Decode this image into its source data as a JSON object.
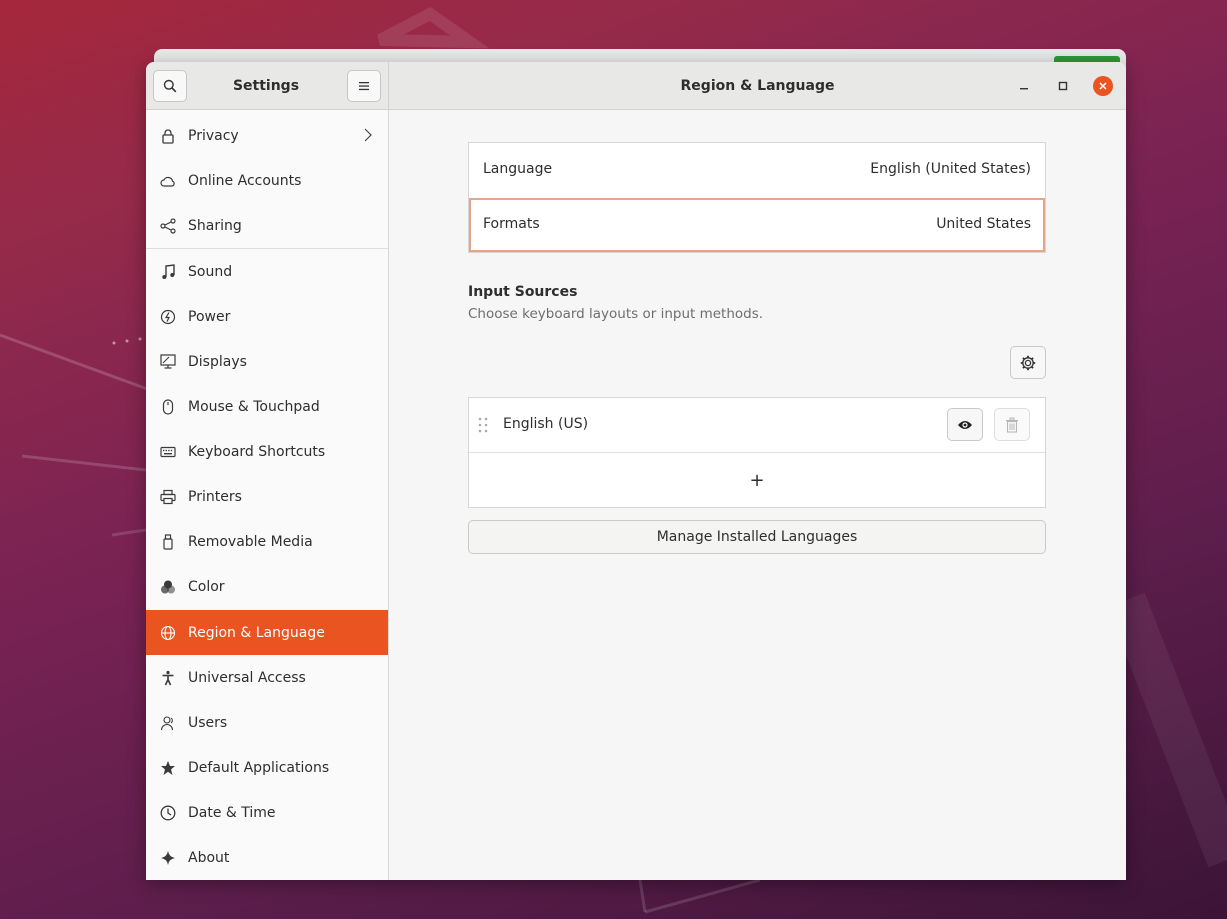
{
  "window": {
    "sidebar_title": "Settings",
    "main_title": "Region & Language"
  },
  "sidebar": {
    "items": [
      {
        "label": "Privacy",
        "icon": "lock-icon"
      },
      {
        "label": "Online Accounts",
        "icon": "cloud-icon"
      },
      {
        "label": "Sharing",
        "icon": "share-icon"
      },
      {
        "label": "Sound",
        "icon": "music-note-icon"
      },
      {
        "label": "Power",
        "icon": "power-icon"
      },
      {
        "label": "Displays",
        "icon": "display-icon"
      },
      {
        "label": "Mouse & Touchpad",
        "icon": "mouse-icon"
      },
      {
        "label": "Keyboard Shortcuts",
        "icon": "keyboard-icon"
      },
      {
        "label": "Printers",
        "icon": "printer-icon"
      },
      {
        "label": "Removable Media",
        "icon": "removable-media-icon"
      },
      {
        "label": "Color",
        "icon": "color-icon"
      },
      {
        "label": "Region & Language",
        "icon": "globe-icon",
        "active": true
      },
      {
        "label": "Universal Access",
        "icon": "accessibility-icon"
      },
      {
        "label": "Users",
        "icon": "users-icon"
      },
      {
        "label": "Default Applications",
        "icon": "star-icon"
      },
      {
        "label": "Date & Time",
        "icon": "clock-icon"
      },
      {
        "label": "About",
        "icon": "sparkle-icon"
      }
    ]
  },
  "region": {
    "language_label": "Language",
    "language_value": "English (United States)",
    "formats_label": "Formats",
    "formats_value": "United States"
  },
  "input_sources": {
    "title": "Input Sources",
    "subtitle": "Choose keyboard layouts or input methods.",
    "sources": [
      {
        "label": "English (US)"
      }
    ],
    "add_symbol": "+",
    "manage_button": "Manage Installed Languages"
  },
  "colors": {
    "accent": "#e95420",
    "formats_border": "#e9a488"
  }
}
